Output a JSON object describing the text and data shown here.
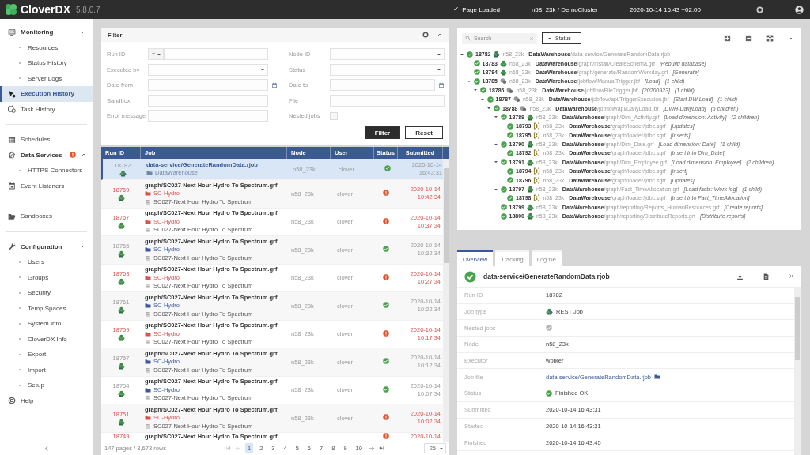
{
  "app": {
    "name": "CloverDX",
    "version": "5.8.0.7"
  },
  "header": {
    "status": "Page Loaded",
    "cluster": "n58_23k / DemoCluster",
    "datetime": "2020-10-14 16:43 +02:00"
  },
  "sidebar": {
    "sections": [
      [
        {
          "label": "Monitoring",
          "kind": "group",
          "expanded": true,
          "selected": false
        },
        {
          "label": "Resources",
          "kind": "sub",
          "selected": false
        },
        {
          "label": "Status History",
          "kind": "sub",
          "selected": false
        },
        {
          "label": "Server Logs",
          "kind": "sub",
          "selected": false
        },
        {
          "label": "Execution History",
          "kind": "item",
          "selected": true
        },
        {
          "label": "Task History",
          "kind": "item",
          "selected": false
        }
      ],
      [
        {
          "label": "Schedules",
          "kind": "item",
          "selected": false
        },
        {
          "label": "Data Services",
          "kind": "group",
          "expanded": true,
          "selected": false,
          "alert": true
        },
        {
          "label": "HTTPS Connectors",
          "kind": "sub",
          "selected": false
        },
        {
          "label": "Event Listeners",
          "kind": "item",
          "selected": false
        }
      ],
      [
        {
          "label": "Sandboxes",
          "kind": "item",
          "selected": false
        }
      ],
      [
        {
          "label": "Configuration",
          "kind": "group",
          "expanded": true,
          "selected": false
        },
        {
          "label": "Users",
          "kind": "sub",
          "selected": false
        },
        {
          "label": "Groups",
          "kind": "sub",
          "selected": false
        },
        {
          "label": "Security",
          "kind": "sub",
          "selected": false
        },
        {
          "label": "Temp Spaces",
          "kind": "sub",
          "selected": false
        },
        {
          "label": "System Info",
          "kind": "sub",
          "selected": false
        },
        {
          "label": "CloverDX Info",
          "kind": "sub",
          "selected": false
        },
        {
          "label": "Export",
          "kind": "sub",
          "selected": false
        },
        {
          "label": "Import",
          "kind": "sub",
          "selected": false
        },
        {
          "label": "Setup",
          "kind": "sub",
          "selected": false
        },
        {
          "label": "Help",
          "kind": "item",
          "selected": false
        }
      ]
    ]
  },
  "filter": {
    "title": "Filter",
    "fields": [
      {
        "label": "Run ID",
        "kind": "id",
        "operator": "="
      },
      {
        "label": "Node ID",
        "kind": "select"
      },
      {
        "label": "Executed by",
        "kind": "select"
      },
      {
        "label": "Status",
        "kind": "select"
      },
      {
        "label": "Date from",
        "kind": "date"
      },
      {
        "label": "Date to",
        "kind": "date"
      },
      {
        "label": "Sandbox",
        "kind": "text"
      },
      {
        "label": "File",
        "kind": "text"
      },
      {
        "label": "Error message",
        "kind": "text"
      },
      {
        "label": "Nested jobs",
        "kind": "checkbox",
        "checked": false
      }
    ],
    "buttons": [
      {
        "label": "Filter",
        "kind": "primary"
      },
      {
        "label": "Reset",
        "kind": "secondary"
      }
    ]
  },
  "table": {
    "columns": [
      "Run ID",
      "Job",
      "Node",
      "User",
      "Status",
      "Submitted"
    ],
    "rows": [
      {
        "run_id": "18782",
        "kind": "rest",
        "failed": false,
        "job": "data-service/GenerateRandomData.rjob",
        "sandbox": "DataWarehouse",
        "node": "n58_23k",
        "user": "clover",
        "date": "2020-10-14",
        "time": "16:43:31",
        "selected": true
      },
      {
        "run_id": "18769",
        "kind": "graph",
        "failed": true,
        "job": "graph/SC027-Next Hour Hydro To Spectrum.grf",
        "sandbox": "SC-Hydro",
        "name": "SC027-Next Hour Hydro To Spectrum",
        "node": "n58_23k",
        "user": "clover",
        "date": "2020-10-14",
        "time": "10:42:34",
        "selected": false
      },
      {
        "run_id": "18767",
        "kind": "graph",
        "failed": true,
        "job": "graph/SC027-Next Hour Hydro To Spectrum.grf",
        "sandbox": "SC-Hydro",
        "name": "SC027-Next Hour Hydro To Spectrum",
        "node": "n58_23k",
        "user": "clover",
        "date": "2020-10-14",
        "time": "10:37:34",
        "selected": false
      },
      {
        "run_id": "18765",
        "kind": "graph",
        "failed": false,
        "job": "graph/SC027-Next Hour Hydro To Spectrum.grf",
        "sandbox": "SC-Hydro",
        "name": "SC027-Next Hour Hydro To Spectrum",
        "node": "n58_23k",
        "user": "clover",
        "date": "2020-10-14",
        "time": "10:32:34",
        "selected": false
      },
      {
        "run_id": "18763",
        "kind": "graph",
        "failed": true,
        "job": "graph/SC027-Next Hour Hydro To Spectrum.grf",
        "sandbox": "SC-Hydro",
        "name": "SC027-Next Hour Hydro To Spectrum",
        "node": "n58_23k",
        "user": "clover",
        "date": "2020-10-14",
        "time": "10:27:34",
        "selected": false
      },
      {
        "run_id": "18761",
        "kind": "graph",
        "failed": false,
        "job": "graph/SC027-Next Hour Hydro To Spectrum.grf",
        "sandbox": "SC-Hydro",
        "name": "SC027-Next Hour Hydro To Spectrum",
        "node": "n58_23k",
        "user": "clover",
        "date": "2020-10-14",
        "time": "10:22:34",
        "selected": false
      },
      {
        "run_id": "18759",
        "kind": "graph",
        "failed": true,
        "job": "graph/SC027-Next Hour Hydro To Spectrum.grf",
        "sandbox": "SC-Hydro",
        "name": "SC027-Next Hour Hydro To Spectrum",
        "node": "n58_23k",
        "user": "clover",
        "date": "2020-10-14",
        "time": "10:17:34",
        "selected": false
      },
      {
        "run_id": "18757",
        "kind": "graph",
        "failed": false,
        "job": "graph/SC027-Next Hour Hydro To Spectrum.grf",
        "sandbox": "SC-Hydro",
        "name": "SC027-Next Hour Hydro To Spectrum",
        "node": "n58_23k",
        "user": "clover",
        "date": "2020-10-14",
        "time": "10:12:34",
        "selected": false
      },
      {
        "run_id": "18754",
        "kind": "graph",
        "failed": false,
        "job": "graph/SC027-Next Hour Hydro To Spectrum.grf",
        "sandbox": "SC-Hydro",
        "name": "SC027-Next Hour Hydro To Spectrum",
        "node": "n58_23k",
        "user": "clover",
        "date": "2020-10-14",
        "time": "10:07:34",
        "selected": false
      },
      {
        "run_id": "18751",
        "kind": "graph",
        "failed": true,
        "job": "graph/SC027-Next Hour Hydro To Spectrum.grf",
        "sandbox": "SC-Hydro",
        "name": "SC027-Next Hour Hydro To Spectrum",
        "node": "n58_23k",
        "user": "clover",
        "date": "2020-10-14",
        "time": "10:02:34",
        "selected": false
      },
      {
        "run_id": "18749",
        "failed": true,
        "job": "graph/SC027-Next Hour Hydro To Spectrum.grf",
        "date": "2020-10-14",
        "selected": false
      }
    ],
    "pagination": {
      "summary": "147 pages / 3,673 rows",
      "pages": [
        {
          "label": "1",
          "selected": true
        },
        {
          "label": "2",
          "selected": false
        },
        {
          "label": "3",
          "selected": false
        },
        {
          "label": "4",
          "selected": false
        },
        {
          "label": "5",
          "selected": false
        },
        {
          "label": "6",
          "selected": false
        },
        {
          "label": "7",
          "selected": false
        },
        {
          "label": "8",
          "selected": false
        },
        {
          "label": "9",
          "selected": false
        },
        {
          "label": "10",
          "selected": false
        }
      ],
      "page_size": "25"
    }
  },
  "tree": {
    "search": {
      "placeholder": "Search"
    },
    "status_button": "Status",
    "nodes": [
      {
        "id": "18782",
        "kind": "rest",
        "failed": false,
        "node": "n58_23k",
        "sandbox": "DataWarehouse",
        "path": "/data-service/GenerateRandomData.rjob",
        "expanded": true,
        "children": [
          {
            "id": "18783",
            "kind": "graph",
            "failed": false,
            "node": "n58_23k",
            "sandbox": "DataWarehouse",
            "path": "/graph/install/CreateSchema.grf",
            "label": "[Rebuild database]"
          },
          {
            "id": "18784",
            "kind": "graph",
            "failed": false,
            "node": "n58_23k",
            "sandbox": "DataWarehouse",
            "path": "/graph/generate/RandomWorkday.grf",
            "label": "[Generate]"
          },
          {
            "id": "18785",
            "kind": "jobflow",
            "failed": false,
            "node": "n58_23k",
            "sandbox": "DataWarehouse",
            "path": "/jobflow/ManualTrigger.jbf",
            "label": "[Load]",
            "count": "(1 child)",
            "expanded": true,
            "children": [
              {
                "id": "18786",
                "kind": "jobflow",
                "failed": false,
                "node": "n58_23k",
                "sandbox": "DataWarehouse",
                "path": "/jobflow/FileTrigger.jbf",
                "label": "[20200923]",
                "count": "(1 child)",
                "expanded": true,
                "children": [
                  {
                    "id": "18787",
                    "kind": "jobflow",
                    "failed": false,
                    "node": "n58_23k",
                    "sandbox": "DataWarehouse",
                    "path": "/jobflow/api/TriggerExecution.jbf",
                    "label": "[Start DW Load]",
                    "count": "(1 child)",
                    "expanded": true,
                    "children": [
                      {
                        "id": "18788",
                        "kind": "jobflow",
                        "failed": false,
                        "node": "n58_23k",
                        "sandbox": "DataWarehouse",
                        "path": "/jobflow/api/DailyLoad.jbf",
                        "label": "[DWH-DailyLoad]",
                        "count": "(6 children)",
                        "expanded": true,
                        "children": [
                          {
                            "id": "18789",
                            "kind": "graph",
                            "failed": false,
                            "node": "n58_23k",
                            "sandbox": "DataWarehouse",
                            "path": "/graph/Dim_Activity.grf",
                            "label": "[Load dimension: Activity]",
                            "count": "(2 children)",
                            "expanded": true,
                            "children": [
                              {
                                "id": "18793",
                                "kind": "subgraph",
                                "failed": false,
                                "node": "n58_23k",
                                "sandbox": "DataWarehouse",
                                "path": "/graph/loader/jdbc.sgrf",
                                "label": "[Updates]"
                              },
                              {
                                "id": "18795",
                                "kind": "subgraph",
                                "failed": false,
                                "node": "n58_23k",
                                "sandbox": "DataWarehouse",
                                "path": "/graph/loader/jdbc.sgrf",
                                "label": "[Inserts]"
                              }
                            ]
                          },
                          {
                            "id": "18790",
                            "kind": "graph",
                            "failed": false,
                            "node": "n58_23k",
                            "sandbox": "DataWarehouse",
                            "path": "/graph/Dim_Date.grf",
                            "label": "[Load dimension: Date]",
                            "count": "(1 child)",
                            "expanded": true,
                            "children": [
                              {
                                "id": "18792",
                                "kind": "subgraph",
                                "failed": false,
                                "node": "n58_23k",
                                "sandbox": "DataWarehouse",
                                "path": "/graph/loader/jdbc.sgrf",
                                "label": "[Insert into Dim_Date]"
                              }
                            ]
                          },
                          {
                            "id": "18791",
                            "kind": "graph",
                            "failed": false,
                            "node": "n58_23k",
                            "sandbox": "DataWarehouse",
                            "path": "/graph/Dim_Employee.grf",
                            "label": "[Load dimension: Employee]",
                            "count": "(2 children)",
                            "expanded": true,
                            "children": [
                              {
                                "id": "18794",
                                "kind": "subgraph",
                                "failed": false,
                                "node": "n58_23k",
                                "sandbox": "DataWarehouse",
                                "path": "/graph/loader/jdbc.sgrf",
                                "label": "[Insert]"
                              },
                              {
                                "id": "18796",
                                "kind": "subgraph",
                                "failed": false,
                                "node": "n58_23k",
                                "sandbox": "DataWarehouse",
                                "path": "/graph/loader/jdbc.sgrf",
                                "label": "[Updates]"
                              }
                            ]
                          },
                          {
                            "id": "18797",
                            "kind": "graph",
                            "failed": false,
                            "node": "n58_23k",
                            "sandbox": "DataWarehouse",
                            "path": "/graph/Fact_TimeAllocation.grf",
                            "label": "[Load facts: Work log]",
                            "count": "(1 child)",
                            "expanded": true,
                            "children": [
                              {
                                "id": "18798",
                                "kind": "subgraph",
                                "failed": false,
                                "node": "n58_23k",
                                "sandbox": "DataWarehouse",
                                "path": "/graph/loader/jdbc.sgrf",
                                "label": "[Insert into Fact_TimeAllocation]"
                              }
                            ]
                          },
                          {
                            "id": "18799",
                            "kind": "graph",
                            "failed": false,
                            "node": "n58_23k",
                            "sandbox": "DataWarehouse",
                            "path": "/graph/reporting/Reports_HumanResources.grf",
                            "label": "[Create reports]"
                          },
                          {
                            "id": "18800",
                            "kind": "graph",
                            "failed": false,
                            "node": "n58_23k",
                            "sandbox": "DataWarehouse",
                            "path": "/graph/reporting/DistributeReports.grf",
                            "label": "[Distribute reports]"
                          }
                        ]
                      }
                    ]
                  }
                ]
              }
            ]
          }
        ]
      }
    ]
  },
  "detail": {
    "tabs": [
      {
        "label": "Overview",
        "selected": true
      },
      {
        "label": "Tracking",
        "selected": false
      },
      {
        "label": "Log file",
        "selected": false
      }
    ],
    "title": "data-service/GenerateRandomData.rjob",
    "failed": false,
    "fields": [
      {
        "label": "Run ID",
        "kind": "text",
        "value": "18782"
      },
      {
        "label": "Job type",
        "kind": "job",
        "value": "REST Job"
      },
      {
        "label": "Nested jobs",
        "kind": "flag",
        "on": false
      },
      {
        "label": "Node",
        "kind": "text",
        "value": "n58_23k"
      },
      {
        "label": "Executor",
        "kind": "text",
        "value": "worker"
      },
      {
        "label": "Job file",
        "kind": "link",
        "value": "data-service/GenerateRandomData.rjob"
      },
      {
        "label": "Status",
        "kind": "status",
        "failed": false,
        "value": "Finished OK"
      },
      {
        "label": "Submitted",
        "kind": "text",
        "value": "2020-10-14 16:43:31"
      },
      {
        "label": "Started",
        "kind": "text",
        "value": "2020-10-14 16:43:31"
      },
      {
        "label": "Finished",
        "kind": "text",
        "value": "2020-10-14 16:43:45"
      }
    ]
  }
}
